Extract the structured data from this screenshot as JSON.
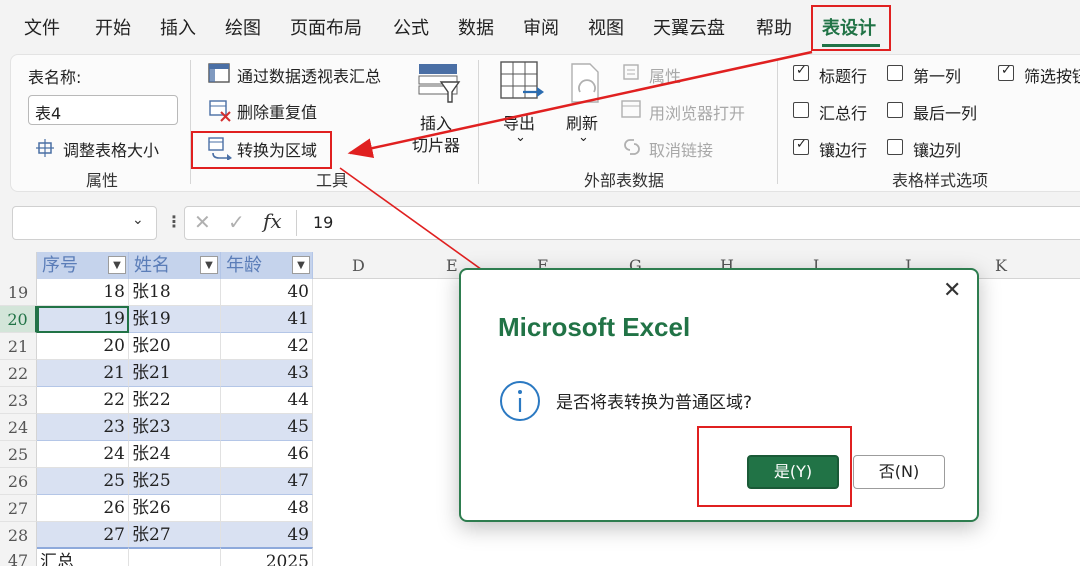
{
  "menu": {
    "tabs": [
      "文件",
      "开始",
      "插入",
      "绘图",
      "页面布局",
      "公式",
      "数据",
      "审阅",
      "视图",
      "天翼云盘",
      "帮助",
      "表设计"
    ],
    "active_tab": "表设计"
  },
  "ribbon": {
    "properties": {
      "table_name_label": "表名称:",
      "table_name_value": "表4",
      "resize_label": "调整表格大小",
      "group_label": "属性"
    },
    "tools": {
      "pivot_label": "通过数据透视表汇总",
      "remove_dup_label": "删除重复值",
      "convert_label": "转换为区域",
      "slicer_label_1": "插入",
      "slicer_label_2": "切片器",
      "group_label": "工具"
    },
    "external": {
      "export_label": "导出",
      "refresh_label": "刷新",
      "properties_label": "属性",
      "browser_label": "用浏览器打开",
      "unlink_label": "取消链接",
      "group_label": "外部表数据"
    },
    "style_options": {
      "header_row": {
        "label": "标题行",
        "checked": true
      },
      "total_row": {
        "label": "汇总行",
        "checked": false
      },
      "banded_rows": {
        "label": "镶边行",
        "checked": true
      },
      "first_col": {
        "label": "第一列",
        "checked": false
      },
      "last_col": {
        "label": "最后一列",
        "checked": false
      },
      "banded_cols": {
        "label": "镶边列",
        "checked": false
      },
      "filter_btn": {
        "label": "筛选按钮",
        "checked": true
      },
      "group_label": "表格样式选项"
    }
  },
  "formula_bar": {
    "fx": "fx",
    "value": "19"
  },
  "sheet": {
    "col_letters": [
      "D",
      "E",
      "F",
      "G",
      "H",
      "I",
      "J",
      "K"
    ],
    "headers": [
      "序号",
      "姓名",
      "年龄"
    ],
    "rows": [
      {
        "row": "19",
        "seq": "18",
        "name": "张18",
        "age": "40"
      },
      {
        "row": "20",
        "seq": "19",
        "name": "张19",
        "age": "41"
      },
      {
        "row": "21",
        "seq": "20",
        "name": "张20",
        "age": "42"
      },
      {
        "row": "22",
        "seq": "21",
        "name": "张21",
        "age": "43"
      },
      {
        "row": "23",
        "seq": "22",
        "name": "张22",
        "age": "44"
      },
      {
        "row": "24",
        "seq": "23",
        "name": "张23",
        "age": "45"
      },
      {
        "row": "25",
        "seq": "24",
        "name": "张24",
        "age": "46"
      },
      {
        "row": "26",
        "seq": "25",
        "name": "张25",
        "age": "47"
      },
      {
        "row": "27",
        "seq": "26",
        "name": "张26",
        "age": "48"
      },
      {
        "row": "28",
        "seq": "27",
        "name": "张27",
        "age": "49"
      }
    ],
    "total_row": {
      "row": "47",
      "label": "汇总",
      "value": "2025"
    }
  },
  "dialog": {
    "title": "Microsoft Excel",
    "message": "是否将表转换为普通区域?",
    "yes_label": "是(Y)",
    "no_label": "否(N)"
  },
  "colors": {
    "accent": "#217346",
    "annotation": "#e02020",
    "band": "#d9e1f2"
  }
}
